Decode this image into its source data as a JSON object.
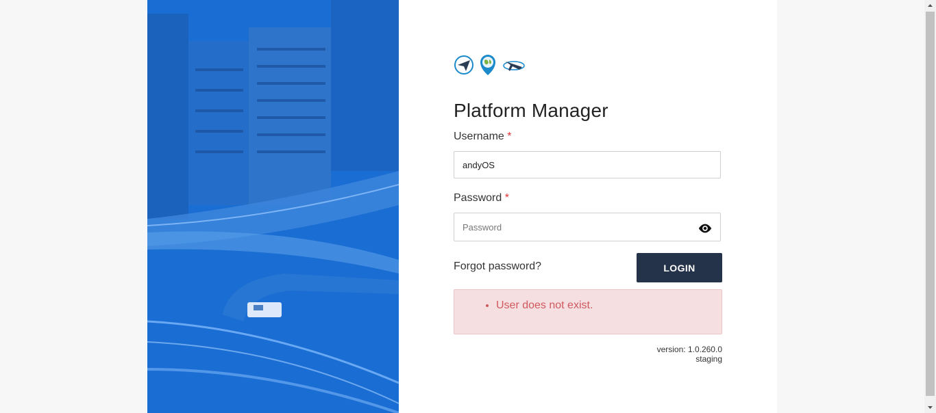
{
  "app": {
    "title": "Platform Manager"
  },
  "logos": [
    "paper-plane-logo-icon",
    "globe-pin-logo-icon",
    "plane-orbit-logo-icon"
  ],
  "form": {
    "username_label": "Username",
    "required_mark": "*",
    "username_value": "andyOS",
    "password_label": "Password",
    "password_placeholder": "Password",
    "forgot_link": "Forgot password?",
    "login_button": "LOGIN"
  },
  "alert": {
    "message": "User does not exist."
  },
  "footer": {
    "version": "version: 1.0.260.0",
    "environment": "staging"
  },
  "colors": {
    "hero_blue": "#1a6fd6",
    "button_dark": "#24334a",
    "error_text": "#d0595f",
    "error_bg": "#f6dfe0",
    "required_red": "#e03131"
  }
}
